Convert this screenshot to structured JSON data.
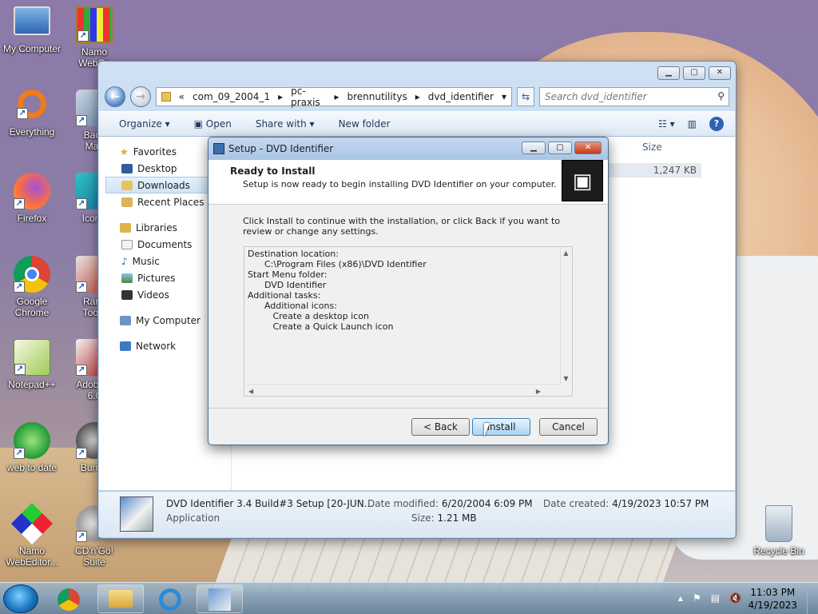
{
  "desktop": {
    "icons": [
      {
        "label": "My Computer"
      },
      {
        "label": "Namo\nWebCa"
      },
      {
        "label": "Everything"
      },
      {
        "label": "Back\nMak"
      },
      {
        "label": "Firefox"
      },
      {
        "label": "IconA"
      },
      {
        "label": "Google\nChrome"
      },
      {
        "label": "Rank\nToolb"
      },
      {
        "label": "Notepad++"
      },
      {
        "label": "Adobe F\n6.0"
      },
      {
        "label": "web to date"
      },
      {
        "label": "Burn'n"
      },
      {
        "label": "Namo\nWebEditor..."
      },
      {
        "label": "CD'n'Go!\nSuite"
      },
      {
        "label": "Recycle Bin"
      }
    ]
  },
  "explorer": {
    "breadcrumb": {
      "overflow": "«",
      "parts": [
        "com_09_2004_1",
        "pc-praxis",
        "brennutilitys",
        "dvd_identifier"
      ]
    },
    "search_placeholder": "Search dvd_identifier",
    "toolbar": {
      "organize": "Organize",
      "open": "Open",
      "share_with": "Share with",
      "new_folder": "New folder"
    },
    "nav": {
      "favorites": "Favorites",
      "desktop": "Desktop",
      "downloads": "Downloads",
      "recent_places": "Recent Places",
      "libraries": "Libraries",
      "documents": "Documents",
      "music": "Music",
      "pictures": "Pictures",
      "videos": "Videos",
      "my_computer": "My Computer",
      "network": "Network"
    },
    "column_size": "Size",
    "file_size": "1,247 KB",
    "details": {
      "name": "DVD Identifier 3.4 Build#3 Setup [20-JUN...",
      "type": "Application",
      "date_modified_label": "Date modified:",
      "date_modified": "6/20/2004 6:09 PM",
      "size_label": "Size:",
      "size": "1.21 MB",
      "date_created_label": "Date created:",
      "date_created": "4/19/2023 10:57 PM"
    }
  },
  "setup": {
    "title": "Setup - DVD Identifier",
    "heading": "Ready to Install",
    "subheading": "Setup is now ready to begin installing DVD Identifier on your computer.",
    "instructions": "Click Install to continue with the installation, or click Back if you want to review or change any settings.",
    "summary": [
      "Destination location:",
      "      C:\\Program Files (x86)\\DVD Identifier",
      "",
      "Start Menu folder:",
      "      DVD Identifier",
      "",
      "Additional tasks:",
      "      Additional icons:",
      "         Create a desktop icon",
      "         Create a Quick Launch icon"
    ],
    "buttons": {
      "back": "< Back",
      "install": "Install",
      "cancel": "Cancel"
    }
  },
  "taskbar": {
    "time": "11:03 PM",
    "date": "4/19/2023"
  }
}
